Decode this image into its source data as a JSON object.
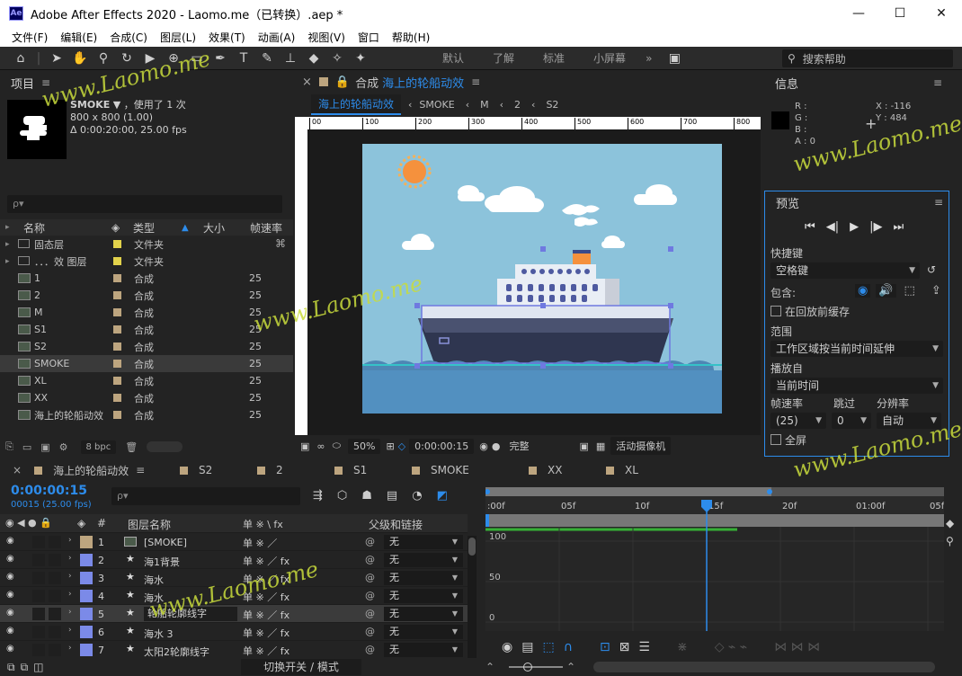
{
  "window": {
    "logo": "Ae",
    "title": "Adobe After Effects 2020 - Laomo.me（已转换）.aep *",
    "min_glyph": "—",
    "max_glyph": "☐",
    "close_glyph": "✕"
  },
  "menu": [
    "文件(F)",
    "编辑(E)",
    "合成(C)",
    "图层(L)",
    "效果(T)",
    "动画(A)",
    "视图(V)",
    "窗口",
    "帮助(H)"
  ],
  "toolbar": {
    "workspaces": [
      "默认",
      "了解",
      "标准",
      "小屏幕"
    ],
    "more": "»",
    "search_placeholder": "搜索帮助"
  },
  "project": {
    "title": "项目",
    "selected_name": "SMOKE",
    "usage": "，使用了 1 次",
    "size": "800 x 800 (1.00)",
    "duration": "Δ 0:00:20:00, 25.00 fps",
    "search_glyph": "ρ▾",
    "columns": {
      "name": "名称",
      "type": "类型",
      "size": "大小",
      "rate": "帧速率"
    },
    "rows": [
      {
        "name": "固态层",
        "type": "文件夹",
        "rate": "",
        "kind": "folder",
        "color": "#e2d24b"
      },
      {
        "name": "．．．效 图层",
        "type": "文件夹",
        "rate": "",
        "kind": "folder",
        "color": "#e2d24b"
      },
      {
        "name": "1",
        "type": "合成",
        "rate": "25",
        "kind": "comp",
        "color": "#bda57f"
      },
      {
        "name": "2",
        "type": "合成",
        "rate": "25",
        "kind": "comp",
        "color": "#bda57f"
      },
      {
        "name": "M",
        "type": "合成",
        "rate": "25",
        "kind": "comp",
        "color": "#bda57f"
      },
      {
        "name": "S1",
        "type": "合成",
        "rate": "25",
        "kind": "comp",
        "color": "#bda57f"
      },
      {
        "name": "S2",
        "type": "合成",
        "rate": "25",
        "kind": "comp",
        "color": "#bda57f"
      },
      {
        "name": "SMOKE",
        "type": "合成",
        "rate": "25",
        "kind": "comp",
        "color": "#bda57f"
      },
      {
        "name": "XL",
        "type": "合成",
        "rate": "25",
        "kind": "comp",
        "color": "#bda57f"
      },
      {
        "name": "XX",
        "type": "合成",
        "rate": "25",
        "kind": "comp",
        "color": "#bda57f"
      },
      {
        "name": "海上的轮船动效",
        "type": "合成",
        "rate": "25",
        "kind": "comp",
        "color": "#bda57f"
      }
    ],
    "bpc": "8 bpc"
  },
  "comp": {
    "tab_prefix": "合成",
    "tab_name": "海上的轮船动效",
    "breadcrumbs": [
      "海上的轮船动效",
      "SMOKE",
      "M",
      "2",
      "S2"
    ],
    "ruler_ticks": [
      "00",
      "100",
      "200",
      "300",
      "400",
      "500",
      "600",
      "700",
      "800"
    ],
    "zoom": "50%",
    "timecode": "0:00:00:15",
    "quality": "完整",
    "camera": "活动摄像机"
  },
  "info": {
    "title": "信息",
    "r": "R :",
    "g": "G :",
    "b": "B :",
    "a": "A : 0",
    "x": "X : -116",
    "y": "Y : 484"
  },
  "preview": {
    "title": "预览",
    "shortcut_label": "快捷键",
    "shortcut_value": "空格键",
    "include_label": "包含:",
    "cache_label": "在回放前缓存",
    "range_label": "范围",
    "range_value": "工作区域按当前时间延伸",
    "playfrom_label": "播放自",
    "playfrom_value": "当前时间",
    "rate_label": "帧速率",
    "skip_label": "跳过",
    "res_label": "分辨率",
    "rate_value": "(25)",
    "skip_value": "0",
    "res_value": "自动",
    "fullscreen_label": "全屏"
  },
  "timeline": {
    "tabs": [
      "海上的轮船动效",
      "S2",
      "2",
      "S1",
      "SMOKE",
      "XX",
      "XL"
    ],
    "current_time": "0:00:00:15",
    "frames": "00015 (25.00 fps)",
    "search_glyph": "ρ▾",
    "col_num": "#",
    "col_name": "图层名称",
    "col_switch": "单 ※ \\ fx",
    "col_parent": "父级和链接",
    "layers": [
      {
        "num": "1",
        "name": "[SMOKE]",
        "color": "#bda57f",
        "parent": "无",
        "type": "comp"
      },
      {
        "num": "2",
        "name": "海1背景",
        "color": "#7b8ae8",
        "parent": "无",
        "type": "shape"
      },
      {
        "num": "3",
        "name": "海水",
        "color": "#7b8ae8",
        "parent": "无",
        "type": "shape"
      },
      {
        "num": "4",
        "name": "海水",
        "color": "#7b8ae8",
        "parent": "无",
        "type": "shape"
      },
      {
        "num": "5",
        "name": "轮船轮廓线字",
        "color": "#7b8ae8",
        "parent": "无",
        "type": "shape"
      },
      {
        "num": "6",
        "name": "海水 3",
        "color": "#7b8ae8",
        "parent": "无",
        "type": "shape"
      },
      {
        "num": "7",
        "name": "太阳2轮廓线字",
        "color": "#7b8ae8",
        "parent": "无",
        "type": "shape"
      }
    ],
    "time_ticks": [
      ":00f",
      "05f",
      "10f",
      "15f",
      "20f",
      "01:00f",
      "05f"
    ],
    "graph_values": [
      "100",
      "50",
      "0"
    ],
    "toggle_label": "切换开关 / 模式"
  },
  "watermark": "www.Laomo.me"
}
